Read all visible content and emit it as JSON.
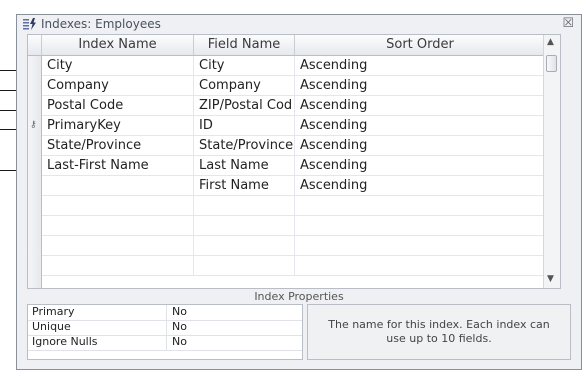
{
  "window": {
    "title": "Indexes: Employees",
    "close_glyph": "☒"
  },
  "grid": {
    "headers": [
      "Index Name",
      "Field Name",
      "Sort Order"
    ],
    "rows": [
      {
        "index_name": "City",
        "field_name": "City",
        "sort_order": "Ascending",
        "primary_key": false
      },
      {
        "index_name": "Company",
        "field_name": "Company",
        "sort_order": "Ascending",
        "primary_key": false
      },
      {
        "index_name": "Postal Code",
        "field_name": "ZIP/Postal Cod",
        "sort_order": "Ascending",
        "primary_key": false
      },
      {
        "index_name": "PrimaryKey",
        "field_name": "ID",
        "sort_order": "Ascending",
        "primary_key": true
      },
      {
        "index_name": "State/Province",
        "field_name": "State/Province",
        "sort_order": "Ascending",
        "primary_key": false
      },
      {
        "index_name": "Last-First Name",
        "field_name": "Last Name",
        "sort_order": "Ascending",
        "primary_key": false
      },
      {
        "index_name": "",
        "field_name": "First Name",
        "sort_order": "Ascending",
        "primary_key": false
      },
      {
        "index_name": "",
        "field_name": "",
        "sort_order": "",
        "primary_key": false
      },
      {
        "index_name": "",
        "field_name": "",
        "sort_order": "",
        "primary_key": false
      },
      {
        "index_name": "",
        "field_name": "",
        "sort_order": "",
        "primary_key": false
      },
      {
        "index_name": "",
        "field_name": "",
        "sort_order": "",
        "primary_key": false
      }
    ]
  },
  "properties": {
    "label": "Index Properties",
    "items": [
      {
        "name": "Primary",
        "value": "No"
      },
      {
        "name": "Unique",
        "value": "No"
      },
      {
        "name": "Ignore Nulls",
        "value": "No"
      }
    ],
    "help_text": "The name for this index. Each index can use up to 10 fields."
  },
  "icons": {
    "title_icon": "indexes-lightning-icon",
    "key_icon": "primary-key-icon",
    "scroll_up": "▲",
    "scroll_down": "▼"
  }
}
